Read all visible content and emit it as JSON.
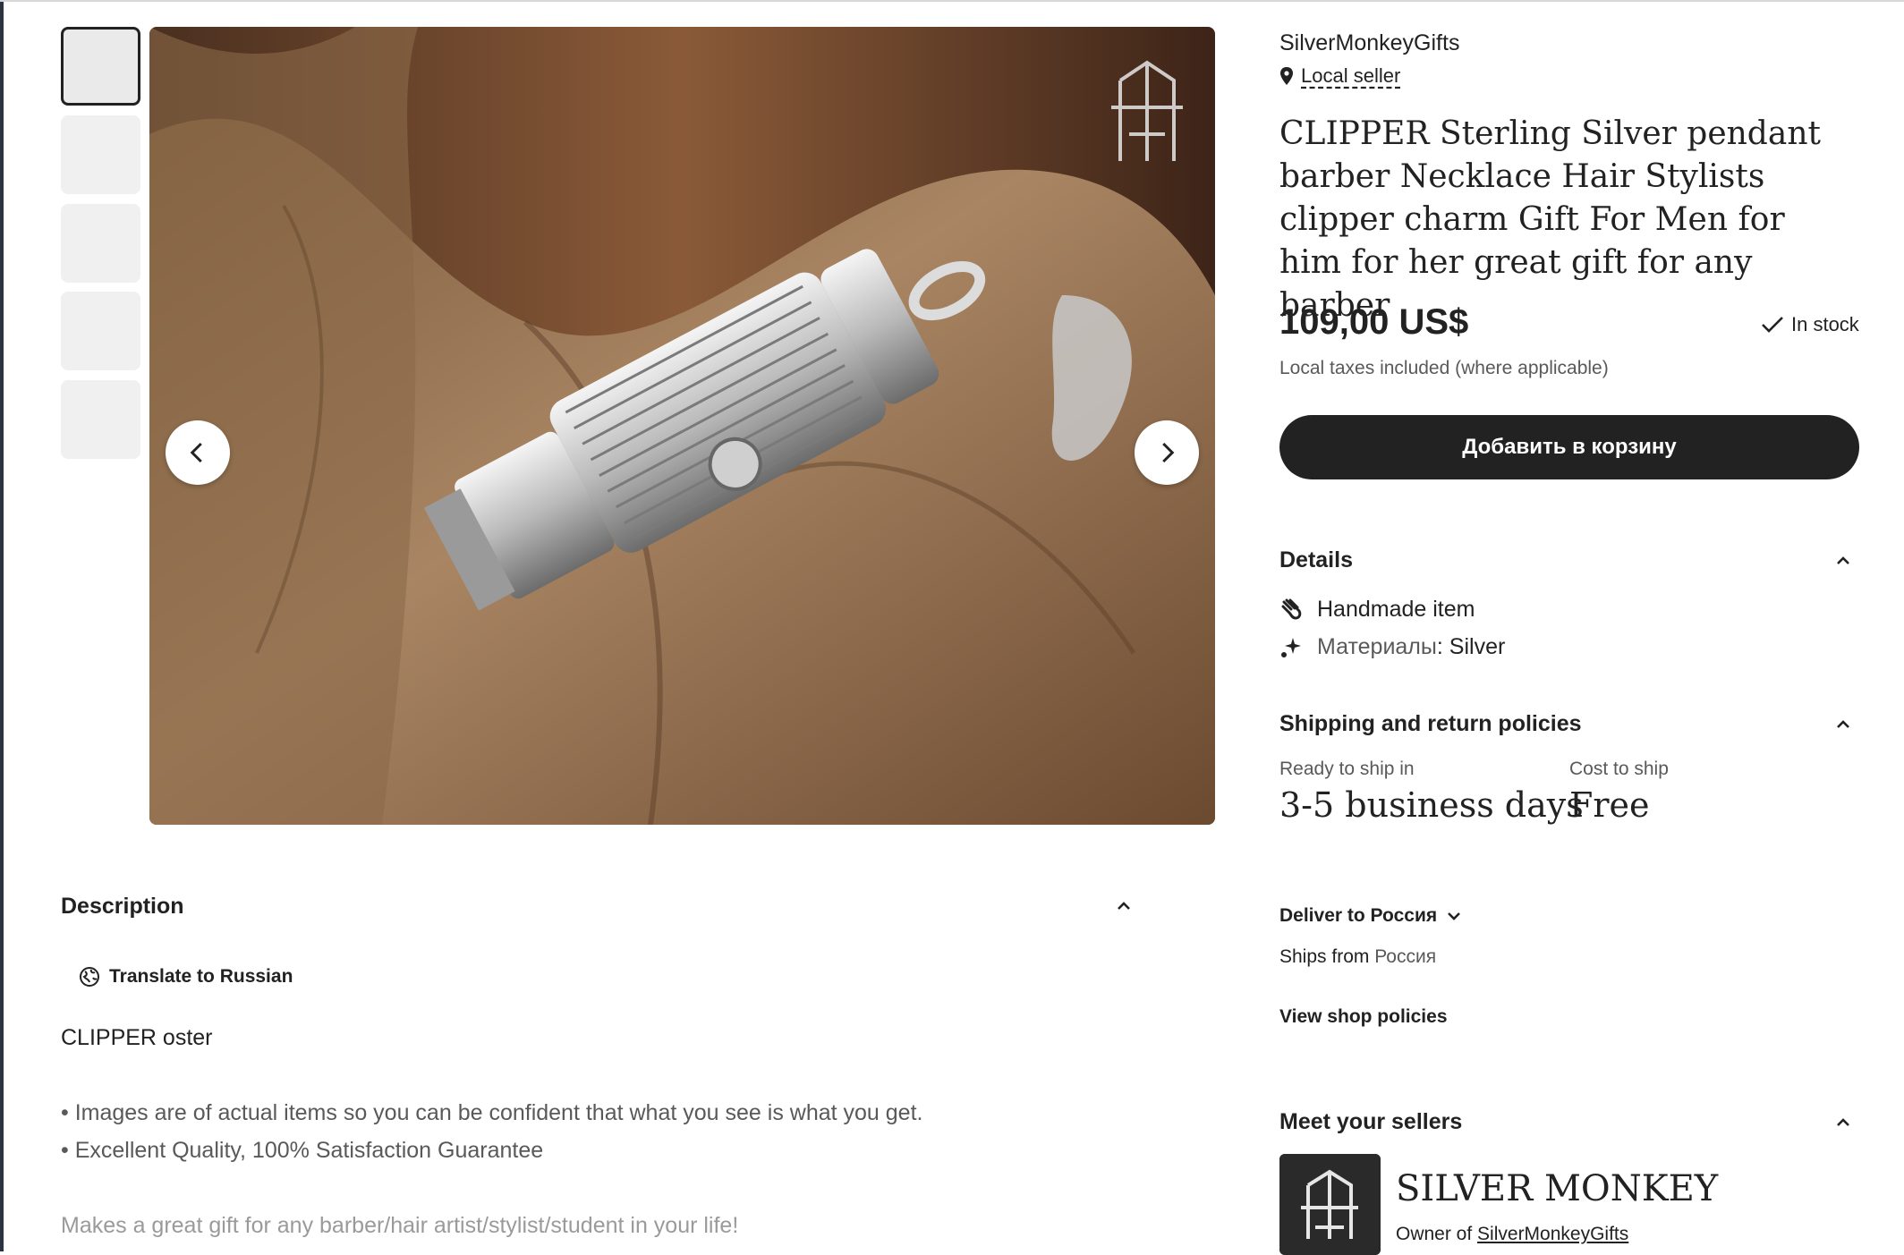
{
  "thumbnails": {
    "count": 5,
    "active_index": 0
  },
  "photo": {
    "alt": "CLIPPER sterling silver pendant on driftwood"
  },
  "shop": {
    "name": "SilverMonkeyGifts",
    "local_seller": "Local seller"
  },
  "listing": {
    "title": "CLIPPER Sterling Silver pendant barber Necklace Hair Stylists clipper charm Gift For Men for him for her great gift for any barber",
    "price": "109,00 US$",
    "stock": "In stock",
    "tax_note": "Local taxes included (where applicable)",
    "add_to_cart": "Добавить в корзину"
  },
  "details": {
    "heading": "Details",
    "handmade": "Handmade item",
    "materials_label": "Материалы",
    "materials_sep": ":",
    "materials_value": "Silver"
  },
  "shipping": {
    "heading": "Shipping and return policies",
    "ready_label": "Ready to ship in",
    "ready_value": "3-5 business days",
    "cost_label": "Cost to ship",
    "cost_value": "Free",
    "deliver_prefix": "Deliver to",
    "deliver_country": "Россия",
    "ships_from_label": "Ships from",
    "ships_from_country": "Россия",
    "view_policies": "View shop policies"
  },
  "sellers": {
    "heading": "Meet your sellers",
    "name": "SILVER MONKEY",
    "owner_prefix": "Owner of",
    "owner_link": "SilverMonkeyGifts"
  },
  "description": {
    "heading": "Description",
    "translate": "Translate to Russian",
    "line1": "CLIPPER oster",
    "bullet1": "• Images are of actual items so you can be confident that what you see is what you get.",
    "bullet2": "• Excellent Quality, 100% Satisfaction Guarantee",
    "line_faded": "Makes a great gift for any barber/hair artist/stylist/student in your life!"
  }
}
